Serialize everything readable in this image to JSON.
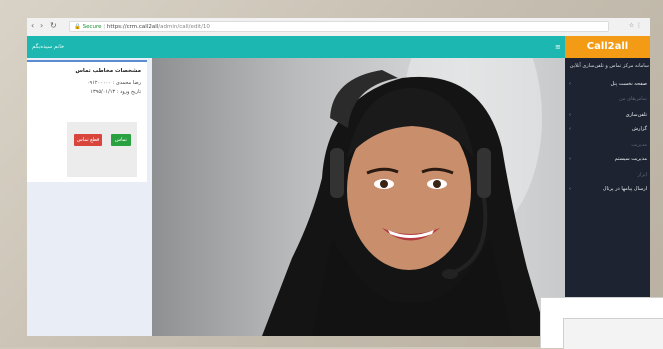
{
  "browser": {
    "security_label": "Secure",
    "url_host": "https://crm.call2all",
    "url_path": "/admin/call/edit/10",
    "right_icons": "☆ ⋮"
  },
  "header": {
    "user_label": "خانم سیده‌بگم",
    "menu_icon": "≡"
  },
  "sidebar": {
    "logo": "Call2all",
    "title": "سامانه مرکز تماس و تلفن‌سازی آنلاین",
    "items": [
      {
        "label": "صفحه نخست پنل",
        "active": true
      },
      {
        "label": "تماس‌های من",
        "active": false
      },
      {
        "label": "تلفن‌سازی",
        "active": true
      },
      {
        "label": "گزارش",
        "active": true
      },
      {
        "label": "مدیریت",
        "active": false
      },
      {
        "label": "مدیریت سیستم",
        "active": true
      },
      {
        "label": "ابزار",
        "active": false
      },
      {
        "label": "ارسال پیامها در پرتال",
        "active": true
      }
    ]
  },
  "contact_card": {
    "title": "مشخصات مخاطب تماس",
    "line1": "رضا محمدی : ۰۹۱۲۰۰۰۰۰",
    "line2": "تاریخ ورود : ۱۳۹۵/۰۱/۱۳",
    "reject_label": "قطع تماس",
    "accept_label": "تماس"
  },
  "colors": {
    "header": "#1bb7b0",
    "logo": "#f49b16",
    "sidebar": "#1d2330",
    "reject": "#d9453d",
    "accept": "#2aa141"
  }
}
